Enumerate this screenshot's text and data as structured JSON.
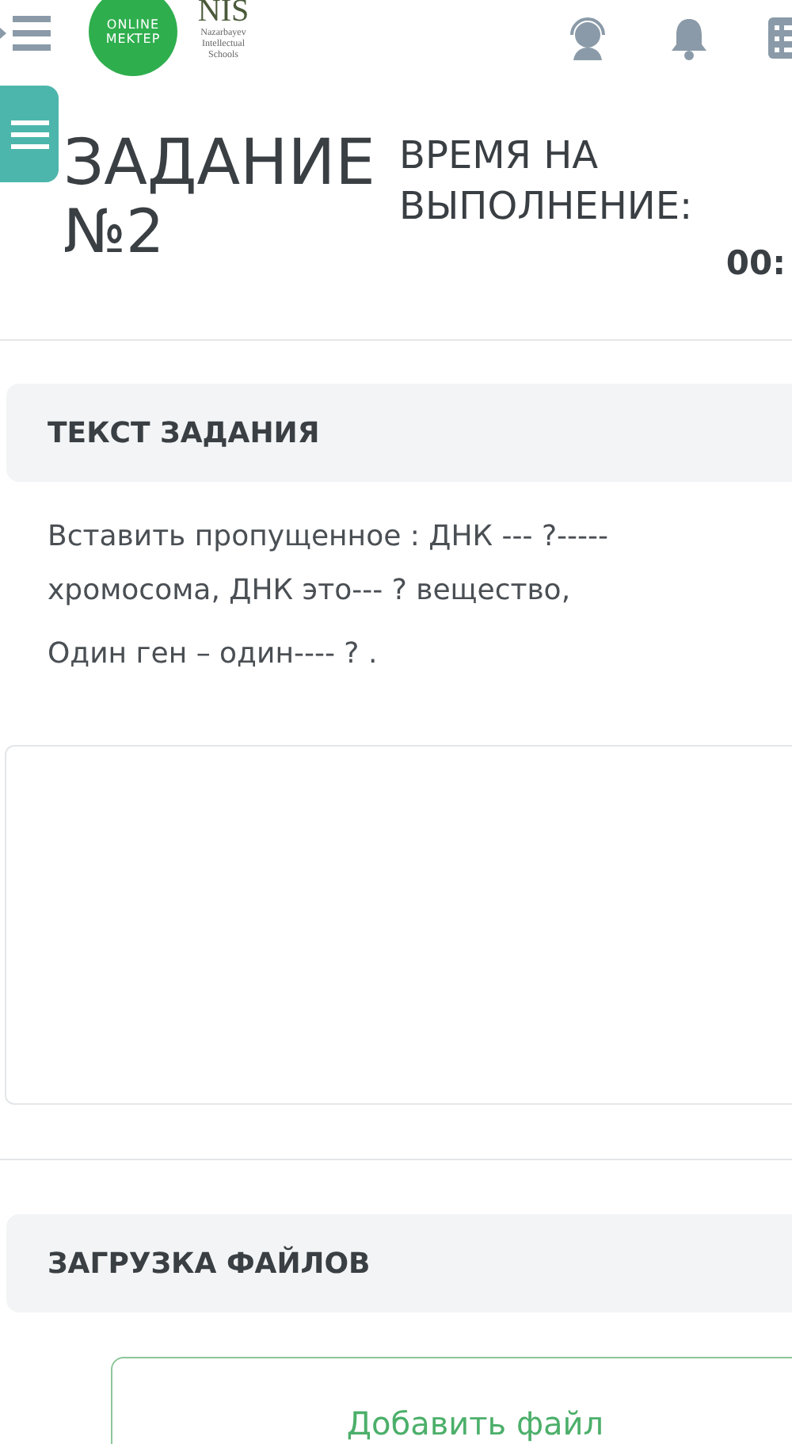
{
  "header": {
    "logo": {
      "line_1": "ONLINE",
      "line_2": "MEKTEP"
    },
    "partner": {
      "name": "NIS",
      "subtitle": "Nazarbayev Intellectual Schools"
    }
  },
  "task": {
    "title": "ЗАДАНИЕ",
    "number": "№2",
    "time_label": "ВРЕМЯ НА ВЫПОЛНЕНИЕ:",
    "time_value": "00:"
  },
  "text_section": {
    "heading": "ТЕКСТ ЗАДАНИЯ",
    "paragraphs": [
      "Вставить пропущенное : ДНК --- ?----- хромосома, ДНК это--- ? вещество,",
      "Один ген – один---- ? ."
    ]
  },
  "upload_section": {
    "heading": "ЗАГРУЗКА ФАЙЛОВ",
    "button": "Добавить файл"
  }
}
